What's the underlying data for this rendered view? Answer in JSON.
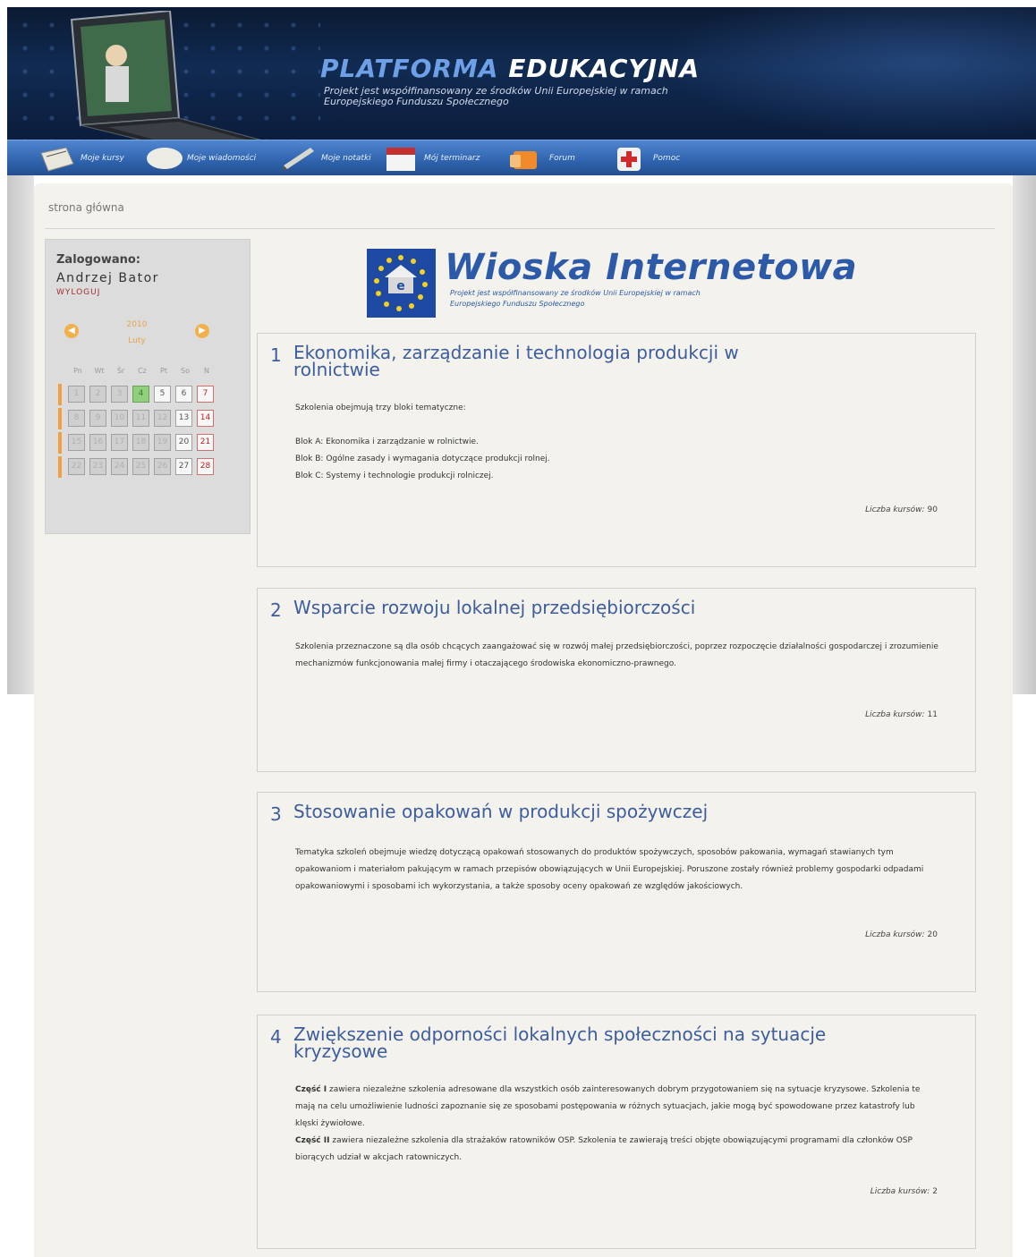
{
  "header": {
    "title_part1": "PLATFORMA",
    "title_part2": "EDUKACYJNA",
    "subtitle": "Projekt jest współfinansowany ze środków Unii Europejskiej w ramach Europejskiego Funduszu Społecznego"
  },
  "nav": [
    {
      "label": "Moje kursy",
      "icon": "books-icon"
    },
    {
      "label": "Moje wiadomości",
      "icon": "mail-icon"
    },
    {
      "label": "Moje notatki",
      "icon": "pen-icon"
    },
    {
      "label": "Mój terminarz",
      "icon": "calendar-icon"
    },
    {
      "label": "Forum",
      "icon": "forum-icon"
    },
    {
      "label": "Pomoc",
      "icon": "help-icon"
    }
  ],
  "breadcrumb": "strona główna",
  "sidebar": {
    "logged_label": "Zalogowano:",
    "user_name": "Andrzej Bator",
    "logout": "WYLOGUJ",
    "calendar": {
      "year": "2010",
      "month": "Luty",
      "weekdays": [
        "Pn",
        "Wt",
        "Śr",
        "Cz",
        "Pt",
        "So",
        "N"
      ],
      "weeks": [
        [
          "1",
          "2",
          "3",
          "4",
          "5",
          "6",
          "7"
        ],
        [
          "8",
          "9",
          "10",
          "11",
          "12",
          "13",
          "14"
        ],
        [
          "15",
          "16",
          "17",
          "18",
          "19",
          "20",
          "21"
        ],
        [
          "22",
          "23",
          "24",
          "25",
          "26",
          "27",
          "28"
        ]
      ],
      "today": "4"
    }
  },
  "logo": {
    "title": "Wioska Internetowa",
    "subtitle": "Projekt jest współfinansowany ze środków Unii Europejskiej w ramach Europejskiego Funduszu Społecznego"
  },
  "courses": [
    {
      "num": "1",
      "title": "Ekonomika, zarządzanie i technologia produkcji w rolnictwie",
      "paragraphs": [
        "Szkolenia obejmują trzy bloki tematyczne:",
        "",
        "Blok A: Ekonomika i zarządzanie w rolnictwie.",
        "Blok B: Ogólne zasady i wymagania dotyczące produkcji rolnej.",
        "Blok C: Systemy i technologie produkcji rolniczej."
      ],
      "count_label": "Liczba kursów:",
      "count": "90"
    },
    {
      "num": "2",
      "title": "Wsparcie rozwoju lokalnej przedsiębiorczości",
      "paragraphs": [
        "Szkolenia przeznaczone są dla osób chcących zaangażować się w rozwój małej przedsiębiorczości, poprzez rozpoczęcie działalności gospodarczej i zrozumienie mechanizmów funkcjonowania małej firmy i otaczającego środowiska ekonomiczno-prawnego."
      ],
      "count_label": "Liczba kursów:",
      "count": "11"
    },
    {
      "num": "3",
      "title": "Stosowanie opakowań w produkcji spożywczej",
      "paragraphs": [
        "Tematyka szkoleń obejmuje wiedzę dotyczącą opakowań stosowanych do produktów spożywczych, sposobów pakowania, wymagań stawianych tym opakowaniom i materiałom pakującym w ramach przepisów obowiązujących w Unii Europejskiej. Poruszone zostały również problemy gospodarki odpadami opakowaniowymi i sposobami ich wykorzystania, a także sposoby oceny opakowań ze względów jakościowych."
      ],
      "count_label": "Liczba kursów:",
      "count": "20"
    },
    {
      "num": "4",
      "title": "Zwiększenie odporności lokalnych społeczności na sytuacje kryzysowe",
      "part1_label": "Część I",
      "part1_text": "zawiera niezależne szkolenia adresowane dla wszystkich osób zainteresowanych dobrym przygotowaniem się na sytuacje kryzysowe. Szkolenia te mają na celu umożliwienie ludności zapoznanie się ze sposobami postępowania w różnych sytuacjach, jakie mogą być spowodowane przez katastrofy lub klęski żywiołowe.",
      "part2_label": "Część II",
      "part2_text": "zawiera niezależne szkolenia dla strażaków ratowników OSP. Szkolenia te zawierają treści objęte obowiązującymi programami dla członków OSP biorących udział w akcjach ratowniczych.",
      "count_label": "Liczba kursów:",
      "count": "2"
    }
  ]
}
